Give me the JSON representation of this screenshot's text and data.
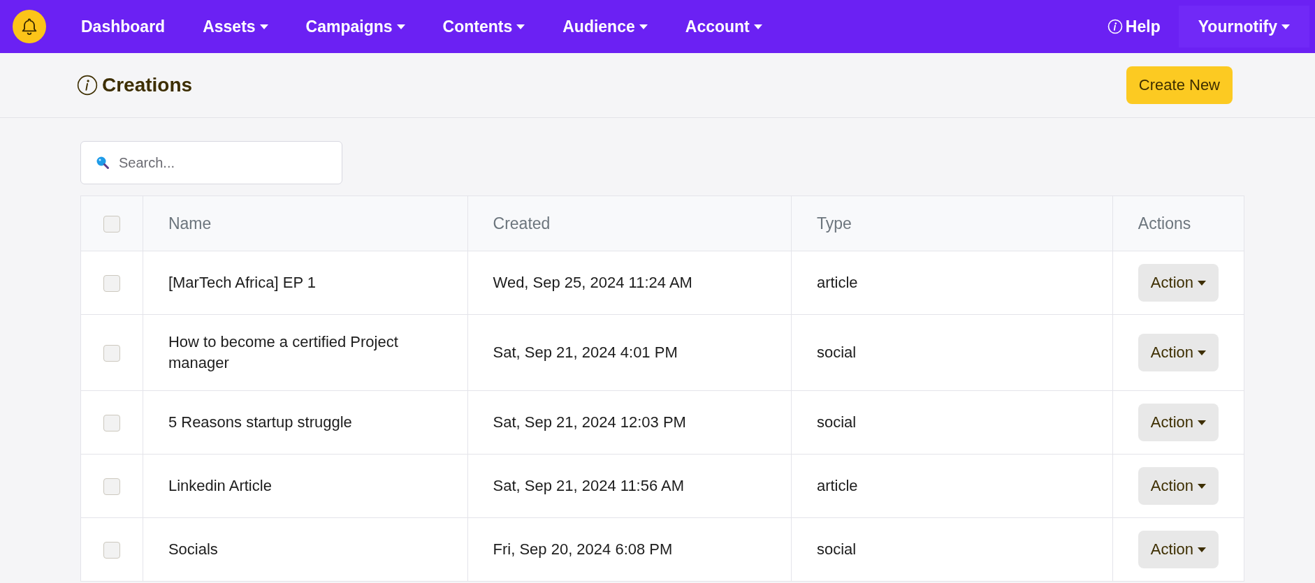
{
  "nav": {
    "items": [
      {
        "label": "Dashboard",
        "dropdown": false
      },
      {
        "label": "Assets",
        "dropdown": true
      },
      {
        "label": "Campaigns",
        "dropdown": true
      },
      {
        "label": "Contents",
        "dropdown": true
      },
      {
        "label": "Audience",
        "dropdown": true
      },
      {
        "label": "Account",
        "dropdown": true
      }
    ],
    "help": "Help",
    "user": "Yournotify"
  },
  "page": {
    "title": "Creations",
    "create_button": "Create New"
  },
  "search": {
    "placeholder": "Search..."
  },
  "table": {
    "select_all_checked": false,
    "columns": [
      "Name",
      "Created",
      "Type",
      "Actions"
    ],
    "rows": [
      {
        "checked": false,
        "name": "[MarTech Africa] EP 1",
        "created": "Wed, Sep 25, 2024 11:24 AM",
        "type": "article",
        "action": "Action"
      },
      {
        "checked": false,
        "name": "How to become a certified Project manager",
        "created": "Sat, Sep 21, 2024 4:01 PM",
        "type": "social",
        "action": "Action"
      },
      {
        "checked": false,
        "name": "5 Reasons startup struggle",
        "created": "Sat, Sep 21, 2024 12:03 PM",
        "type": "social",
        "action": "Action"
      },
      {
        "checked": false,
        "name": "Linkedin Article",
        "created": "Sat, Sep 21, 2024 11:56 AM",
        "type": "article",
        "action": "Action"
      },
      {
        "checked": false,
        "name": "Socials",
        "created": "Fri, Sep 20, 2024 6:08 PM",
        "type": "social",
        "action": "Action"
      }
    ]
  }
}
